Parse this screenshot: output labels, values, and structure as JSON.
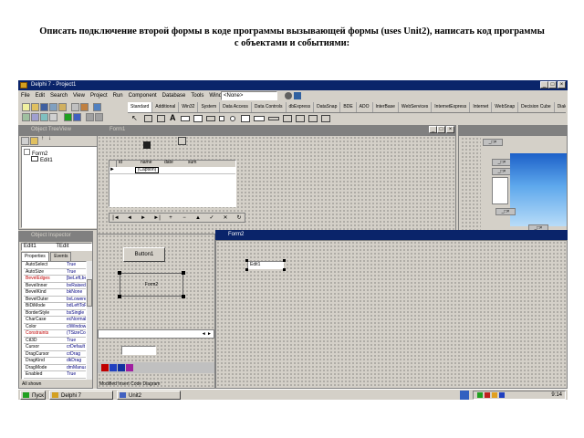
{
  "document": {
    "heading_line1": "Описать подключение второй формы в коде программы вызывающей формы (uses Unit2),  написать код программы",
    "heading_line2": "с объектами и событиями:"
  },
  "ide": {
    "window_title": "Delphi 7 - Project1",
    "menu": [
      "File",
      "Edit",
      "Search",
      "View",
      "Project",
      "Run",
      "Component",
      "Database",
      "Tools",
      "Window",
      "Help"
    ],
    "desktop_select": "<None>",
    "palette_tabs": [
      "Standard",
      "Additional",
      "Win32",
      "System",
      "Data Access",
      "Data Controls",
      "dbExpress",
      "DataSnap",
      "BDE",
      "ADO",
      "InterBase",
      "WebServices",
      "InternetExpress",
      "Internet",
      "WebSnap",
      "Decision Cube",
      "Dialogs"
    ],
    "active_palette_tab": "Standard"
  },
  "tree_view": {
    "title": "Object TreeView",
    "items": [
      "Form2",
      "Edit1"
    ]
  },
  "inspector": {
    "title": "Object Inspector",
    "selected": "Edit1",
    "selected_type": "TEdit",
    "tabs": [
      "Properties",
      "Events"
    ],
    "rows": [
      {
        "name": "AutoSelect",
        "value": "True",
        "highlight": false
      },
      {
        "name": "AutoSize",
        "value": "True",
        "highlight": false
      },
      {
        "name": "BevelEdges",
        "value": "[beLeft,beTop",
        "highlight": true
      },
      {
        "name": "BevelInner",
        "value": "bvRaised",
        "highlight": false
      },
      {
        "name": "BevelKind",
        "value": "bkNone",
        "highlight": false
      },
      {
        "name": "BevelOuter",
        "value": "bvLowered",
        "highlight": false
      },
      {
        "name": "BiDiMode",
        "value": "bdLeftToRight",
        "highlight": false
      },
      {
        "name": "BorderStyle",
        "value": "bsSingle",
        "highlight": false
      },
      {
        "name": "CharCase",
        "value": "ecNormal",
        "highlight": false
      },
      {
        "name": "Color",
        "value": "clWindow",
        "highlight": false
      },
      {
        "name": "Constraints",
        "value": "(TSizeConstr",
        "highlight": true
      },
      {
        "name": "Ctl3D",
        "value": "True",
        "highlight": false
      },
      {
        "name": "Cursor",
        "value": "crDefault",
        "highlight": false
      },
      {
        "name": "DragCursor",
        "value": "crDrag",
        "highlight": false
      },
      {
        "name": "DragKind",
        "value": "dkDrag",
        "highlight": false
      },
      {
        "name": "DragMode",
        "value": "dmManual",
        "highlight": false
      },
      {
        "name": "Enabled",
        "value": "True",
        "highlight": false
      },
      {
        "name": "Font",
        "value": "(TFont)",
        "highlight": true
      },
      {
        "name": "Height",
        "value": "21",
        "highlight": false
      },
      {
        "name": "HelpContext",
        "value": "0",
        "highlight": false
      },
      {
        "name": "HelpKeyword",
        "value": "",
        "highlight": false
      },
      {
        "name": "HelpType",
        "value": "htContext",
        "highlight": false
      },
      {
        "name": "Hint",
        "value": "",
        "highlight": false
      }
    ],
    "status": "All shown"
  },
  "form1": {
    "title": "Form1",
    "grid_headers": [
      "id",
      "name",
      "date",
      "sum"
    ],
    "grid_cell": "(Caption)",
    "navigator": [
      "|◄",
      "◄",
      "►",
      "►|",
      "+",
      "−",
      "▲",
      "✓",
      "✕",
      "↻"
    ],
    "button_caption": "Button1",
    "group_caption": "Form2"
  },
  "form2": {
    "title": "Form2",
    "edit_text": "Edit1"
  },
  "editor": {
    "status_text": "Modified   Insert   Code   Diagram"
  },
  "taskbar": {
    "start_label": "Пуск",
    "items": [
      "Delphi 7",
      "Unit2"
    ],
    "clock": "9:14"
  }
}
